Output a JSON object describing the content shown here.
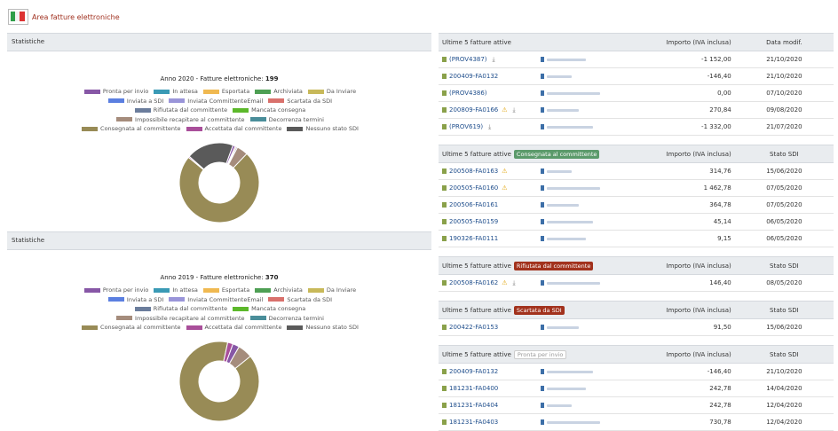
{
  "app": {
    "title": "Area fatture elettroniche",
    "logo_icon": "invoice-logo"
  },
  "stats": [
    {
      "header": "Statistiche",
      "title_prefix": "Anno 2020 - Fatture elettroniche:",
      "total": "199",
      "legend": [
        "Pronta per invio",
        "In attesa",
        "Esportata",
        "Archiviata",
        "Da Inviare",
        "Inviata a SDI",
        "Inviata CommittenteEmail",
        "Scartata da SDI",
        "Rifiutata dal committente",
        "Mancata consegna",
        "Impossibile recapitare al committente",
        "Decorrenza termini",
        "Consegnata al committente",
        "Accettata dal committente",
        "Nessuno stato SDI"
      ],
      "chart_data": {
        "type": "pie",
        "categories": [
          "Pronta per invio",
          "In attesa",
          "Esportata",
          "Archiviata",
          "Da Inviare",
          "Inviata a SDI",
          "Inviata CommittenteEmail",
          "Scartata da SDI",
          "Rifiutata dal committente",
          "Mancata consegna",
          "Impossibile recapitare al committente",
          "Decorrenza termini",
          "Consegnata al committente",
          "Accettata dal committente",
          "Nessuno stato SDI"
        ],
        "values": [
          2,
          0,
          0,
          0,
          0,
          0,
          0,
          1,
          1,
          0,
          9,
          0,
          147,
          1,
          38
        ],
        "colors": [
          "#8757a6",
          "#3a9ab5",
          "#f0b951",
          "#4e9f54",
          "#c8b95a",
          "#5b7fe0",
          "#9a95d9",
          "#d9716c",
          "#6b7d9c",
          "#5cb82b",
          "#a58c7c",
          "#4a8e9a",
          "#988b56",
          "#a94f9a",
          "#5a5a5a"
        ],
        "hole": "donut"
      }
    },
    {
      "header": "Statistiche",
      "title_prefix": "Anno 2019 - Fatture elettroniche:",
      "total": "370",
      "legend": [
        "Pronta per invio",
        "In attesa",
        "Esportata",
        "Archiviata",
        "Da Inviare",
        "Inviata a SDI",
        "Inviata CommittenteEmail",
        "Scartata da SDI",
        "Rifiutata dal committente",
        "Mancata consegna",
        "Impossibile recapitare al committente",
        "Decorrenza termini",
        "Consegnata al committente",
        "Accettata dal committente",
        "Nessuno stato SDI"
      ],
      "chart_data": {
        "type": "pie",
        "categories": [
          "Pronta per invio",
          "In attesa",
          "Esportata",
          "Archiviata",
          "Da Inviare",
          "Inviata a SDI",
          "Inviata CommittenteEmail",
          "Scartata da SDI",
          "Rifiutata dal committente",
          "Mancata consegna",
          "Impossibile recapitare al committente",
          "Decorrenza termini",
          "Consegnata al committente",
          "Accettata dal committente",
          "Nessuno stato SDI"
        ],
        "values": [
          10,
          0,
          0,
          0,
          0,
          0,
          0,
          0,
          0,
          0,
          22,
          0,
          330,
          8,
          0
        ],
        "colors": [
          "#8757a6",
          "#3a9ab5",
          "#f0b951",
          "#4e9f54",
          "#c8b95a",
          "#5b7fe0",
          "#9a95d9",
          "#d9716c",
          "#6b7d9c",
          "#5cb82b",
          "#a58c7c",
          "#4a8e9a",
          "#988b56",
          "#a94f9a",
          "#5a5a5a"
        ],
        "hole": "donut"
      }
    }
  ],
  "tables": [
    {
      "title": "Ultime 5 fatture attive",
      "badge": "",
      "badge_style": "",
      "col_amount": "Importo (IVA inclusa)",
      "col_date": "Data modif.",
      "rows": [
        {
          "id": "(PROV4387)",
          "warn": false,
          "download": true,
          "amount": "-1 152,00",
          "date": "21/10/2020"
        },
        {
          "id": "200409-FA0132",
          "warn": false,
          "download": false,
          "amount": "-146,40",
          "date": "21/10/2020"
        },
        {
          "id": "(PROV4386)",
          "warn": false,
          "download": false,
          "amount": "0,00",
          "date": "07/10/2020"
        },
        {
          "id": "200809-FA0166",
          "warn": true,
          "download": true,
          "amount": "270,84",
          "date": "09/08/2020"
        },
        {
          "id": "(PROV619)",
          "warn": false,
          "download": true,
          "amount": "-1 332,00",
          "date": "21/07/2020"
        }
      ]
    },
    {
      "title": "Ultime 5 fatture attive",
      "badge": "Consegnata al committente",
      "badge_style": "green",
      "col_amount": "Importo (IVA inclusa)",
      "col_date": "Stato SDI",
      "rows": [
        {
          "id": "200508-FA0163",
          "warn": true,
          "download": false,
          "amount": "314,76",
          "date": "15/06/2020"
        },
        {
          "id": "200505-FA0160",
          "warn": true,
          "download": false,
          "amount": "1 462,78",
          "date": "07/05/2020"
        },
        {
          "id": "200506-FA0161",
          "warn": false,
          "download": false,
          "amount": "364,78",
          "date": "07/05/2020"
        },
        {
          "id": "200505-FA0159",
          "warn": false,
          "download": false,
          "amount": "45,14",
          "date": "06/05/2020"
        },
        {
          "id": "190326-FA0111",
          "warn": false,
          "download": false,
          "amount": "9,15",
          "date": "06/05/2020"
        }
      ]
    },
    {
      "title": "Ultime 5 fatture attive",
      "badge": "Rifiutata dal committente",
      "badge_style": "red",
      "col_amount": "Importo (IVA inclusa)",
      "col_date": "Stato SDI",
      "rows": [
        {
          "id": "200508-FA0162",
          "warn": true,
          "download": true,
          "amount": "146,40",
          "date": "08/05/2020"
        }
      ]
    },
    {
      "title": "Ultime 5 fatture attive",
      "badge": "Scartata da SDI",
      "badge_style": "red",
      "col_amount": "Importo (IVA inclusa)",
      "col_date": "Stato SDI",
      "rows": [
        {
          "id": "200422-FA0153",
          "warn": false,
          "download": false,
          "amount": "91,50",
          "date": "15/06/2020"
        }
      ]
    },
    {
      "title": "Ultime 5 fatture attive",
      "badge": "Pronta per invio",
      "badge_style": "white",
      "col_amount": "Importo (IVA inclusa)",
      "col_date": "Stato SDI",
      "rows": [
        {
          "id": "200409-FA0132",
          "warn": false,
          "download": false,
          "amount": "-146,40",
          "date": "21/10/2020"
        },
        {
          "id": "181231-FA0400",
          "warn": false,
          "download": false,
          "amount": "242,78",
          "date": "14/04/2020"
        },
        {
          "id": "181231-FA0404",
          "warn": false,
          "download": false,
          "amount": "242,78",
          "date": "12/04/2020"
        },
        {
          "id": "181231-FA0403",
          "warn": false,
          "download": false,
          "amount": "730,78",
          "date": "12/04/2020"
        }
      ]
    }
  ]
}
